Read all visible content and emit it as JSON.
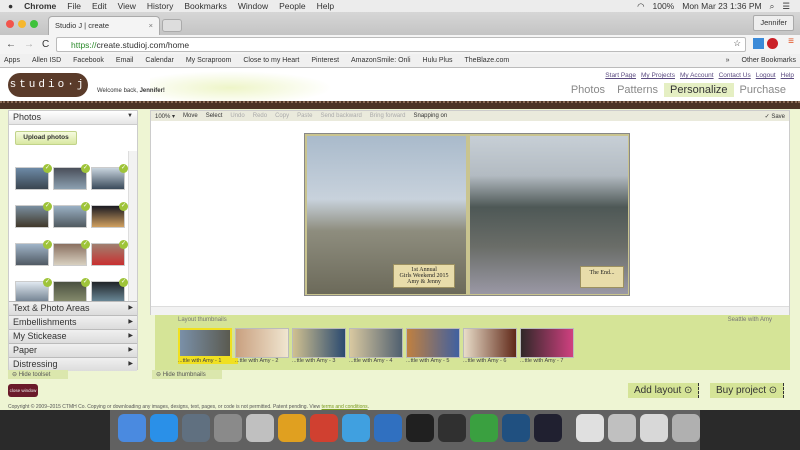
{
  "menubar": {
    "apple": "",
    "app": "Chrome",
    "items": [
      "File",
      "Edit",
      "View",
      "History",
      "Bookmarks",
      "Window",
      "People",
      "Help"
    ],
    "battery": "100%",
    "clock": "Mon Mar 23  1:36 PM"
  },
  "browser": {
    "tab_title": "Studio J | create",
    "tab_close": "×",
    "user": "Jennifer",
    "url_scheme": "https://",
    "url_rest": "create.studioj.com/home",
    "bookmarks": [
      "Apps",
      "Allen ISD",
      "Facebook",
      "Email",
      "Calendar",
      "My Scraproom",
      "Close to my Heart",
      "Pinterest",
      "AmazonSmile: Onli",
      "Hulu Plus",
      "TheBlaze.com"
    ],
    "more": "»",
    "other": "Other Bookmarks"
  },
  "site": {
    "logo": "studio·j",
    "welcome": "Welcome back, ",
    "user": "Jennifer!",
    "links": [
      "Start Page",
      "My Projects",
      "My Account",
      "Contact Us",
      "Logout",
      "Help"
    ],
    "steps": [
      "Photos",
      "Patterns",
      "Personalize",
      "Purchase"
    ],
    "active_step": "Personalize"
  },
  "left": {
    "panel": "Photos",
    "upload": "Upload photos",
    "accordion": [
      "Text & Photo Areas",
      "Embellishments",
      "My Stickease",
      "Paper",
      "Distressing"
    ],
    "hide": "Hide toolset"
  },
  "toolbar": {
    "zoom": "100% ▾",
    "items": [
      "Move",
      "Select",
      "Undo",
      "Redo",
      "Copy",
      "Paste",
      "Send backward",
      "Bring forward",
      "Snapping on"
    ],
    "save": "✓ Save"
  },
  "canvas": {
    "left_text": [
      "1st Annual",
      "Girls Weekend 2015",
      "Amy & Jenny"
    ],
    "right_text": "The End..."
  },
  "thumbs": {
    "title": "Layout thumbnails",
    "project": "Seattle with Amy",
    "labels": [
      "...ttle with Amy - 1",
      "...ttle with Amy - 2",
      "...ttle with Amy - 3",
      "...ttle with Amy - 4",
      "...ttle with Amy - 5",
      "...ttle with Amy - 6",
      "...ttle with Amy - 7"
    ],
    "hide": "Hide thumbnails"
  },
  "footer": {
    "close": "close window",
    "add": "Add layout",
    "buy": "Buy project",
    "copyright": "Copyright © 2009–2015 CTMH Co. Copying or downloading any images, designs, text, pages, or code is not permitted. Patent pending. View ",
    "terms": "terms and conditions",
    "terms_end": "."
  },
  "colors": {
    "accent": "#d5e497",
    "brown": "#4c3224",
    "maroon": "#6a1a2a"
  }
}
